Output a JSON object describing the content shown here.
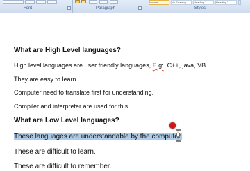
{
  "ribbon": {
    "groups": [
      {
        "label": "Font"
      },
      {
        "label": "Paragraph"
      },
      {
        "label": "Styles"
      }
    ],
    "style_gallery": [
      "Normal",
      "No Spacing",
      "Heading 1",
      "Heading 2"
    ]
  },
  "document": {
    "heading_high": "What are High Level languages?",
    "line_1_before": "High level languages are user friendly languages, ",
    "line_1_eg": "E.g:",
    "line_1_after": "  C++, java, VB",
    "line_2": "They are easy to learn.",
    "line_3": "Computer need to translate first for understanding.",
    "line_4": "Compiler and interpreter are used for this.",
    "heading_low": "What are Low Level languages?",
    "selected_line": "These languages are understandable by the computer.",
    "line_6": "These are difficult to learn.",
    "line_7": "These are difficult to remember."
  },
  "colors": {
    "selection": "#aecbe8",
    "pointer_highlight": "#cf1717",
    "ribbon": "#dbe5f3"
  }
}
